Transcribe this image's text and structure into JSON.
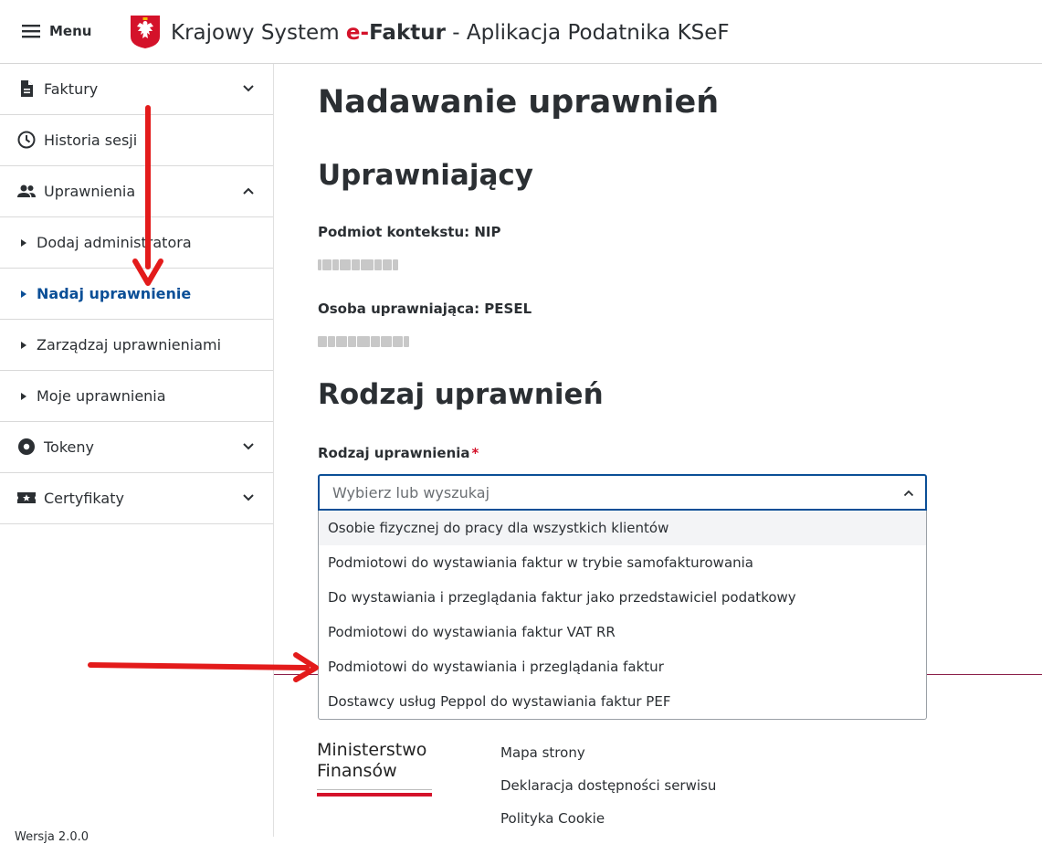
{
  "header": {
    "menu_label": "Menu",
    "title_prefix": "Krajowy System ",
    "title_brand_e": "e-",
    "title_brand_rest": "Faktur",
    "title_suffix": " - Aplikacja Podatnika KSeF"
  },
  "sidebar": {
    "items": [
      {
        "label": "Faktury",
        "icon": "document-icon",
        "expanded": false
      },
      {
        "label": "Historia sesji",
        "icon": "clock-icon"
      },
      {
        "label": "Uprawnienia",
        "icon": "people-icon",
        "expanded": true
      },
      {
        "label": "Dodaj administratora"
      },
      {
        "label": "Nadaj uprawnienie",
        "active": true
      },
      {
        "label": "Zarządzaj uprawnieniami"
      },
      {
        "label": "Moje uprawnienia"
      },
      {
        "label": "Tokeny",
        "icon": "token-icon",
        "expanded": false
      },
      {
        "label": "Certyfikaty",
        "icon": "certificate-icon",
        "expanded": false
      }
    ],
    "version": "Wersja 2.0.0"
  },
  "main": {
    "page_title": "Nadawanie uprawnień",
    "section_grantor": "Uprawniający",
    "context_label": "Podmiot kontekstu: NIP",
    "person_label": "Osoba uprawniająca: PESEL",
    "section_type": "Rodzaj uprawnień",
    "type_field_label": "Rodzaj uprawnienia",
    "required_mark": "*",
    "select_placeholder": "Wybierz lub wyszukaj",
    "options": [
      "Osobie fizycznej do pracy dla wszystkich klientów",
      "Podmiotowi do wystawiania faktur w trybie samofakturowania",
      "Do wystawiania i przeglądania faktur jako przedstawiciel podatkowy",
      "Podmiotowi do wystawiania faktur VAT RR",
      "Podmiotowi do wystawiania i przeglądania faktur",
      "Dostawcy usług Peppol do wystawiania faktur PEF"
    ]
  },
  "footer": {
    "ministry_line1": "Ministerstwo",
    "ministry_line2": "Finansów",
    "links": [
      "Mapa strony",
      "Deklaracja dostępności serwisu",
      "Polityka Cookie"
    ]
  },
  "colors": {
    "accent_blue": "#0b4f97",
    "brand_red": "#d4122a",
    "annotation_red": "#e31b1b"
  }
}
